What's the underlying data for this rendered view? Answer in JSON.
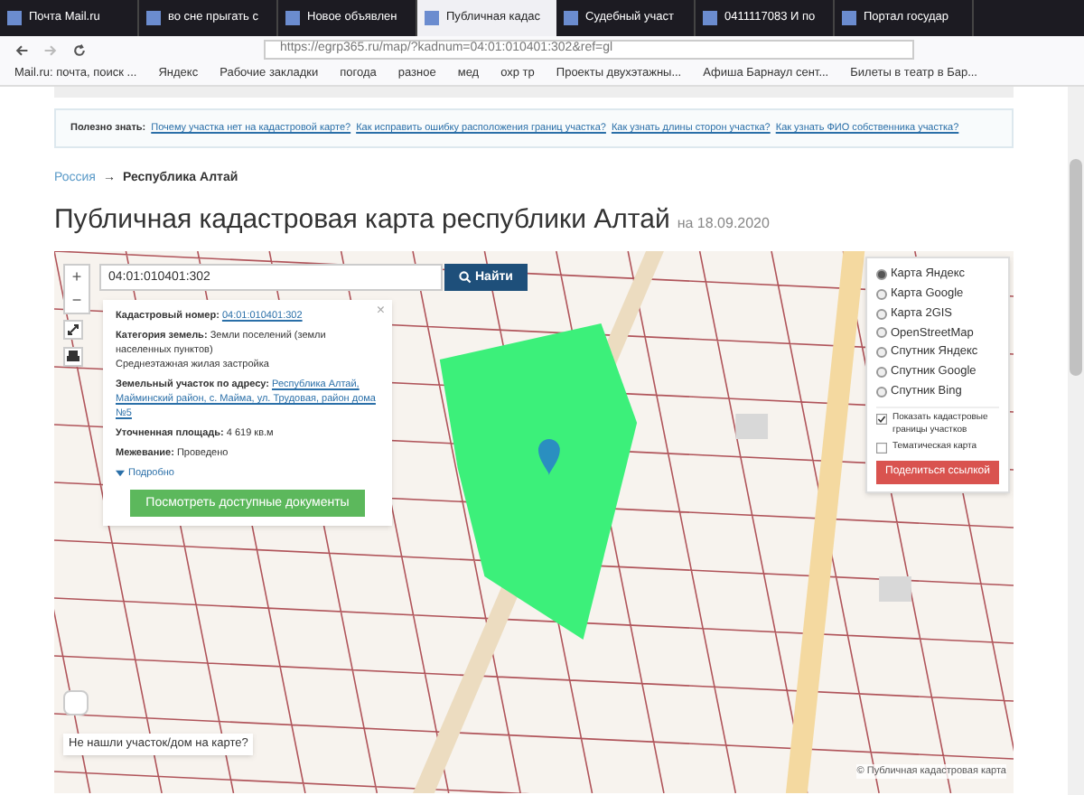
{
  "tabs": [
    {
      "label": "Почта Mail.ru",
      "selected": false
    },
    {
      "label": "во сне прыгать с",
      "selected": false
    },
    {
      "label": "Новое объявлен",
      "selected": false
    },
    {
      "label": "Публичная кадас",
      "selected": true
    },
    {
      "label": "Судебный участ",
      "selected": false
    },
    {
      "label": "0411117083 И по",
      "selected": false
    },
    {
      "label": "Портал государ",
      "selected": false
    }
  ],
  "url": "https://egrp365.ru/map/?kadnum=04:01:010401:302&ref=gl",
  "bookmarks": [
    "Mail.ru: почта, поиск ...",
    "Яндекс",
    "Рабочие закладки",
    "погода",
    "разное",
    "мед",
    "охр тр",
    "Проекты двухэтажны...",
    "Афиша Барнаул сент...",
    "Билеты в театр в Бар..."
  ],
  "info": {
    "label": "Полезно знать:",
    "links": [
      "Почему участка нет на кадастровой карте?",
      "Как исправить ошибку расположения границ участка?",
      "Как узнать длины сторон участка?",
      "Как узнать ФИО собственника участка?"
    ]
  },
  "breadcrumb": {
    "link": "Россия",
    "arrow": "→",
    "current": "Республика Алтай"
  },
  "title": "Публичная кадастровая карта республики Алтай",
  "date": "на 18.09.2020",
  "search": {
    "value": "04:01:010401:302",
    "button": "Найти"
  },
  "zoom_buttons": [
    "+",
    "−"
  ],
  "popup": {
    "close": "×",
    "cad_label": "Кадастровый номер:",
    "cad_value": "04:01:010401:302",
    "cat_label": "Категория земель:",
    "cat_value": "Земли поселений (земли населенных пунктов)",
    "use": "Среднеэтажная жилая застройка",
    "addr_label": "Земельный участок по адресу:",
    "addr_value": "Республика Алтай, Майминский район, с. Майма, ул. Трудовая, район дома №5",
    "area_label": "Уточненная площадь:",
    "area_value": "4 619 кв.м",
    "survey_label": "Межевание:",
    "survey_value": "Проведено",
    "more": "Подробно",
    "docs_button": "Посмотреть доступные документы"
  },
  "layers": [
    {
      "label": "Карта Яндекс",
      "selected": true
    },
    {
      "label": "Карта Google",
      "selected": false
    },
    {
      "label": "Карта 2GIS",
      "selected": false
    },
    {
      "label": "OpenStreetMap",
      "selected": false
    },
    {
      "label": "Спутник Яндекс",
      "selected": false
    },
    {
      "label": "Спутник Google",
      "selected": false
    },
    {
      "label": "Спутник Bing",
      "selected": false
    }
  ],
  "options": [
    {
      "label": "Показать кадастровые границы участков",
      "checked": true
    },
    {
      "label": "Тематическая карта",
      "checked": false
    }
  ],
  "share_button": "Поделиться ссылкой",
  "not_found": "Не нашли участок/дом на карте?",
  "attribution": "© Публичная кадастровая карта"
}
